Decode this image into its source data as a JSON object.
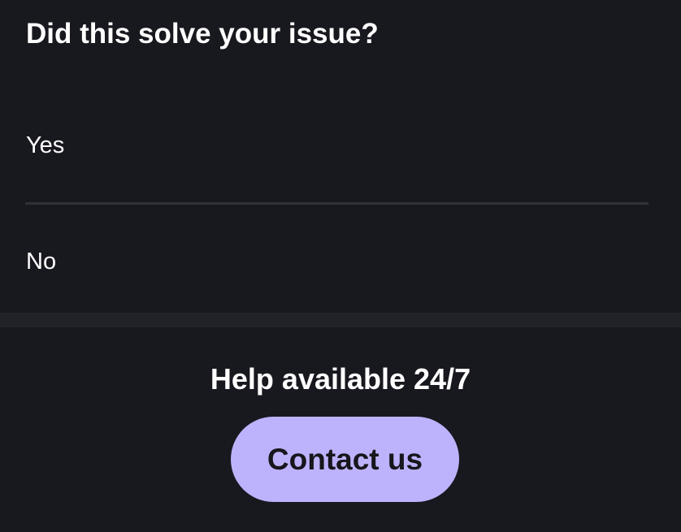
{
  "feedback": {
    "question": "Did this solve your issue?",
    "options": [
      "Yes",
      "No"
    ]
  },
  "help": {
    "title": "Help available 24/7",
    "contact_label": "Contact us",
    "accent_color": "#bdb3fc"
  }
}
